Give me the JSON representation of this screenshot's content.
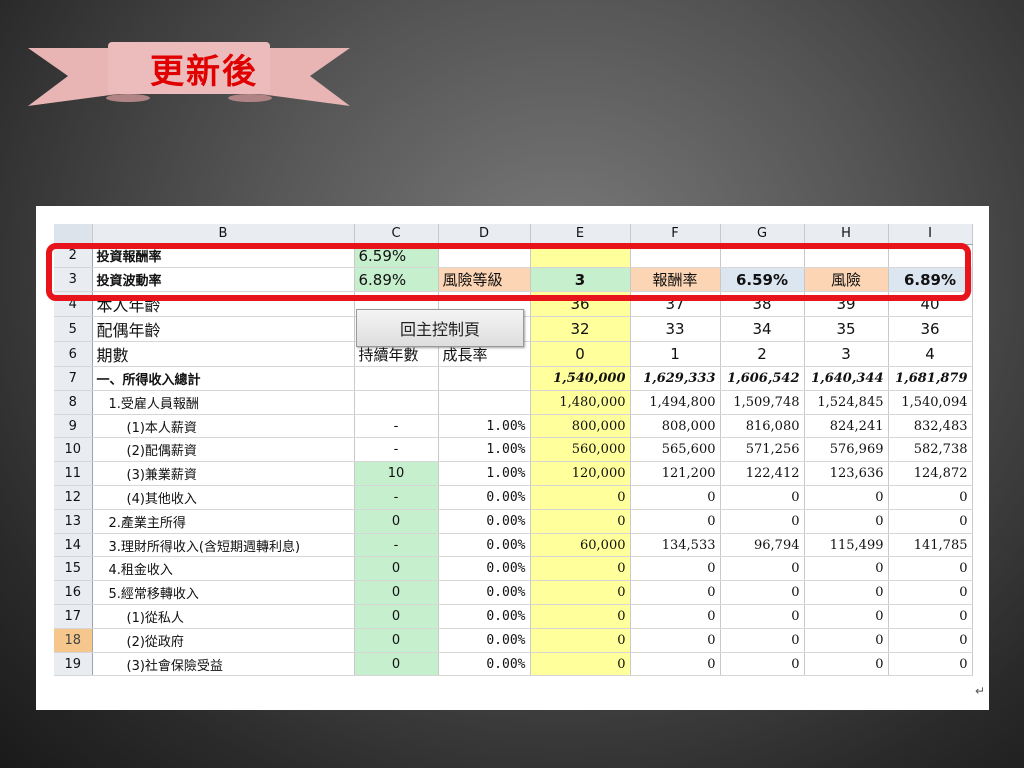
{
  "ribbon": {
    "title": "更新後"
  },
  "sheet": {
    "columns": [
      "B",
      "C",
      "D",
      "E",
      "F",
      "G",
      "H",
      "I"
    ],
    "control_button": "回主控制頁",
    "rows": [
      {
        "num": "2",
        "label": "投資報酬率",
        "c": "6.59%",
        "d": "",
        "e": "",
        "f": "",
        "g": "",
        "h": "",
        "i": ""
      },
      {
        "num": "3",
        "label": "投資波動率",
        "c": "6.89%",
        "d": "風險等級",
        "e": "3",
        "f": "報酬率",
        "g": "6.59%",
        "h": "風險",
        "i": "6.89%"
      },
      {
        "num": "4",
        "label": "本人年齡",
        "c": "",
        "d": "",
        "e": "36",
        "f": "37",
        "g": "38",
        "h": "39",
        "i": "40"
      },
      {
        "num": "5",
        "label": "配偶年齡",
        "c": "",
        "d": "",
        "e": "32",
        "f": "33",
        "g": "34",
        "h": "35",
        "i": "36"
      },
      {
        "num": "6",
        "label": "期數",
        "c": "持續年數",
        "d": "成長率",
        "e": "0",
        "f": "1",
        "g": "2",
        "h": "3",
        "i": "4"
      },
      {
        "num": "7",
        "label": "一、所得收入總計",
        "c": "",
        "d": "",
        "e": "1,540,000",
        "f": "1,629,333",
        "g": "1,606,542",
        "h": "1,640,344",
        "i": "1,681,879"
      },
      {
        "num": "8",
        "label": "1.受雇人員報酬",
        "c": "",
        "d": "",
        "e": "1,480,000",
        "f": "1,494,800",
        "g": "1,509,748",
        "h": "1,524,845",
        "i": "1,540,094"
      },
      {
        "num": "9",
        "label": "(1)本人薪資",
        "c": "-",
        "d": "1.00%",
        "e": "800,000",
        "f": "808,000",
        "g": "816,080",
        "h": "824,241",
        "i": "832,483"
      },
      {
        "num": "10",
        "label": "(2)配偶薪資",
        "c": "-",
        "d": "1.00%",
        "e": "560,000",
        "f": "565,600",
        "g": "571,256",
        "h": "576,969",
        "i": "582,738"
      },
      {
        "num": "11",
        "label": "(3)兼業薪資",
        "c": "10",
        "d": "1.00%",
        "e": "120,000",
        "f": "121,200",
        "g": "122,412",
        "h": "123,636",
        "i": "124,872"
      },
      {
        "num": "12",
        "label": "(4)其他收入",
        "c": "-",
        "d": "0.00%",
        "e": "0",
        "f": "0",
        "g": "0",
        "h": "0",
        "i": "0"
      },
      {
        "num": "13",
        "label": "2.產業主所得",
        "c": "0",
        "d": "0.00%",
        "e": "0",
        "f": "0",
        "g": "0",
        "h": "0",
        "i": "0"
      },
      {
        "num": "14",
        "label": "3.理財所得收入(含短期週轉利息)",
        "c": "-",
        "d": "0.00%",
        "e": "60,000",
        "f": "134,533",
        "g": "96,794",
        "h": "115,499",
        "i": "141,785"
      },
      {
        "num": "15",
        "label": "4.租金收入",
        "c": "0",
        "d": "0.00%",
        "e": "0",
        "f": "0",
        "g": "0",
        "h": "0",
        "i": "0"
      },
      {
        "num": "16",
        "label": "5.經常移轉收入",
        "c": "0",
        "d": "0.00%",
        "e": "0",
        "f": "0",
        "g": "0",
        "h": "0",
        "i": "0"
      },
      {
        "num": "17",
        "label": "(1)從私人",
        "c": "0",
        "d": "0.00%",
        "e": "0",
        "f": "0",
        "g": "0",
        "h": "0",
        "i": "0"
      },
      {
        "num": "18",
        "label": "(2)從政府",
        "c": "0",
        "d": "0.00%",
        "e": "0",
        "f": "0",
        "g": "0",
        "h": "0",
        "i": "0"
      },
      {
        "num": "19",
        "label": "(3)社會保險受益",
        "c": "0",
        "d": "0.00%",
        "e": "0",
        "f": "0",
        "g": "0",
        "h": "0",
        "i": "0"
      }
    ]
  },
  "colors": {
    "highlight": "#e8141c",
    "ribbon": "#e8b4b4",
    "title_text": "#e00000",
    "green_cell": "#c6efce",
    "yellow_cell": "#ffff9c",
    "orange_cell": "#fcd5b4",
    "blue_cell": "#dce6f1"
  }
}
